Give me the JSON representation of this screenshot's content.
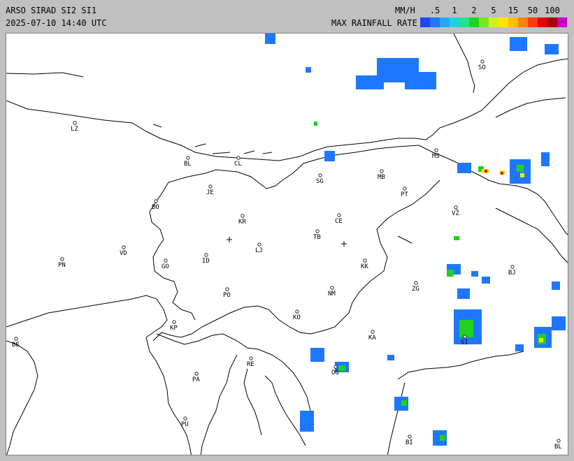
{
  "header": {
    "title": "ARSO SIRAD SI2 SI1",
    "timestamp": "2025-07-10 14:40 UTC",
    "unit": "MM/H",
    "legend_title": "MAX RAINFALL RATE"
  },
  "legend": {
    "ticks": [
      ".5",
      "1",
      "2",
      "5",
      "15",
      "50",
      "100"
    ],
    "colors": [
      "#1e46ff",
      "#1e78ff",
      "#1eaaff",
      "#1ed2e6",
      "#1ee68c",
      "#1ed21e",
      "#78e61e",
      "#d2f01e",
      "#ffe600",
      "#ffbe00",
      "#ff8200",
      "#ff3c00",
      "#e60000",
      "#aa0000",
      "#c800c8"
    ]
  },
  "cities": [
    {
      "code": "LZ"
    },
    {
      "code": "BL"
    },
    {
      "code": "CL"
    },
    {
      "code": "JE"
    },
    {
      "code": "BO"
    },
    {
      "code": "KR"
    },
    {
      "code": "SG"
    },
    {
      "code": "MB"
    },
    {
      "code": "MS"
    },
    {
      "code": "SO"
    },
    {
      "code": "PT"
    },
    {
      "code": "CE"
    },
    {
      "code": "VŽ"
    },
    {
      "code": "TB"
    },
    {
      "code": "VD"
    },
    {
      "code": "LJ"
    },
    {
      "code": "PN"
    },
    {
      "code": "GO"
    },
    {
      "code": "ID"
    },
    {
      "code": "KK"
    },
    {
      "code": "BJ"
    },
    {
      "code": "ZG"
    },
    {
      "code": "PO"
    },
    {
      "code": "NM"
    },
    {
      "code": "KO"
    },
    {
      "code": "KP"
    },
    {
      "code": "KA"
    },
    {
      "code": "SI"
    },
    {
      "code": "BE"
    },
    {
      "code": "RE"
    },
    {
      "code": "PA"
    },
    {
      "code": "OG"
    },
    {
      "code": "PU"
    },
    {
      "code": "BI"
    },
    {
      "code": "BL"
    }
  ]
}
